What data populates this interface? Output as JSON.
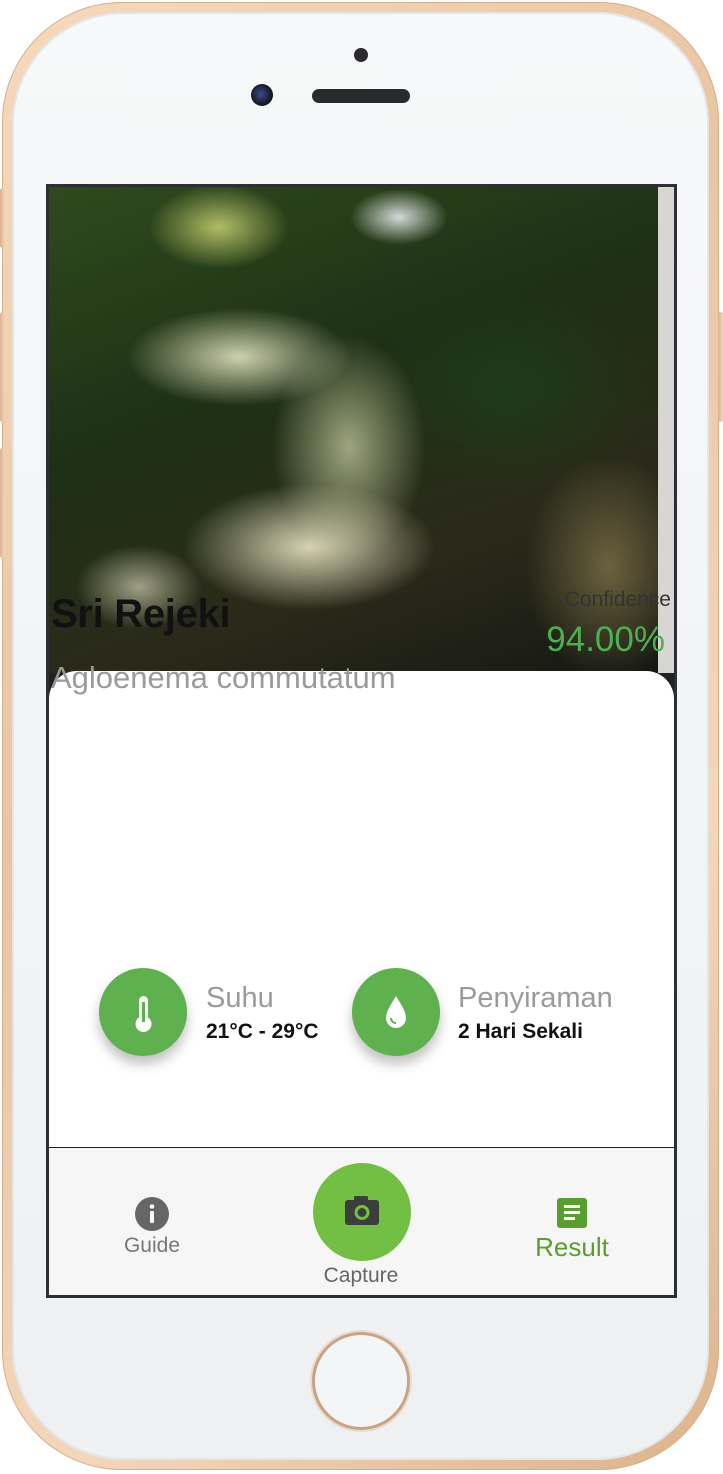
{
  "photo": {
    "description_icon": "plant-photo"
  },
  "result": {
    "name": "Sri Rejeki",
    "scientific_name": "Agloenema commutatum",
    "confidence_label": "Confidence",
    "confidence_value": "94.00%"
  },
  "care": [
    {
      "icon": "thermometer-icon",
      "title": "Suhu",
      "value": "21°C - 29°C"
    },
    {
      "icon": "water-drop-icon",
      "title": "Penyiraman",
      "value": "2 Hari Sekali"
    }
  ],
  "nav": {
    "guide": {
      "label": "Guide",
      "icon": "info-icon"
    },
    "capture": {
      "label": "Capture",
      "icon": "camera-icon"
    },
    "result": {
      "label": "Result",
      "icon": "document-icon"
    }
  },
  "colors": {
    "accent": "#4caf50",
    "capture": "#72bf44",
    "result_active": "#5a9e2f",
    "icon_circle": "#5fb04f"
  }
}
